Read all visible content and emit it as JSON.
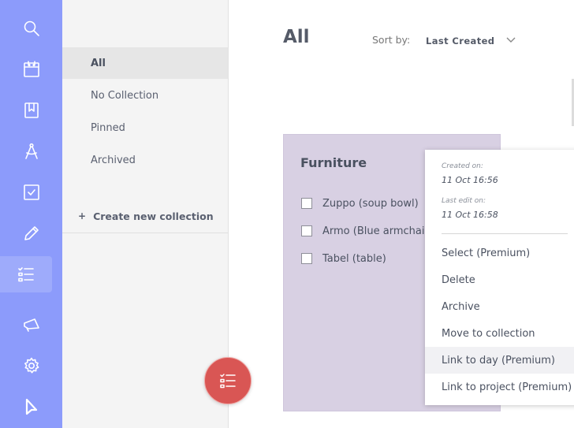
{
  "rail": {
    "icons": [
      "search-icon",
      "calendar-icon",
      "bookmark-icon",
      "compass-icon",
      "checkbox-icon",
      "pencil-icon",
      "checklist-icon",
      "megaphone-icon",
      "gear-icon",
      "logo-icon"
    ],
    "active": "checklist-icon",
    "color": "#8c9bfb"
  },
  "collections": {
    "items": [
      {
        "label": "All",
        "active": true
      },
      {
        "label": "No Collection",
        "active": false
      },
      {
        "label": "Pinned",
        "active": false
      },
      {
        "label": "Archived",
        "active": false
      }
    ],
    "create_plus": "+",
    "create_label": "Create new collection"
  },
  "main": {
    "title": "All",
    "sort_label": "Sort by:",
    "sort_value": "Last Created"
  },
  "card": {
    "title": "Furniture",
    "background": "#d8d0e3",
    "items": [
      {
        "label": "Zuppo (soup bowl)",
        "checked": false
      },
      {
        "label": "Armo (Blue armchair",
        "checked": false
      },
      {
        "label": "Tabel (table)",
        "checked": false
      }
    ]
  },
  "menu": {
    "created_label": "Created on:",
    "created_value": "11 Oct 16:56",
    "edited_label": "Last edit on:",
    "edited_value": "11 Oct 16:58",
    "items": [
      {
        "label": "Select (Premium)"
      },
      {
        "label": "Delete"
      },
      {
        "label": "Archive"
      },
      {
        "label": "Move to collection"
      },
      {
        "label": "Link to day (Premium)",
        "hover": true
      },
      {
        "label": "Link to project (Premium)"
      }
    ]
  },
  "fab": {
    "icon": "checklist-icon",
    "color": "#d95654"
  }
}
